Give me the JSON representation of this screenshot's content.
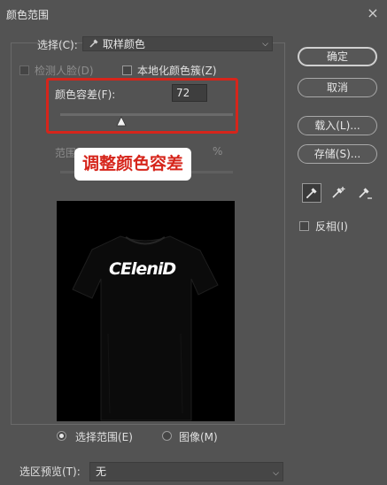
{
  "window": {
    "title": "颜色范围",
    "close_icon": "×"
  },
  "select_row": {
    "label": "选择(C):",
    "value": "取样颜色"
  },
  "detect_faces": {
    "label": "检测人脸(D)"
  },
  "localized": {
    "label": "本地化颜色簇(Z)"
  },
  "fuzziness": {
    "label": "颜色容差(F):",
    "value": "72"
  },
  "range": {
    "label_fragment": "范围",
    "percent_fragment": "%"
  },
  "annotation": {
    "text": "调整颜色容差",
    "color": "#d6251b"
  },
  "preview": {
    "text": "CEleniD"
  },
  "view_mode": {
    "selection_label": "选择范围(E)",
    "image_label": "图像(M)",
    "selected": "selection"
  },
  "selection_preview": {
    "label": "选区预览(T):",
    "value": "无"
  },
  "buttons": {
    "ok": "确定",
    "cancel": "取消",
    "load": "载入(L)...",
    "save": "存储(S)..."
  },
  "invert": {
    "label": "反相(I)",
    "checked": false
  },
  "tools": [
    "eyedropper-icon",
    "eyedropper-plus-icon",
    "eyedropper-minus-icon"
  ]
}
